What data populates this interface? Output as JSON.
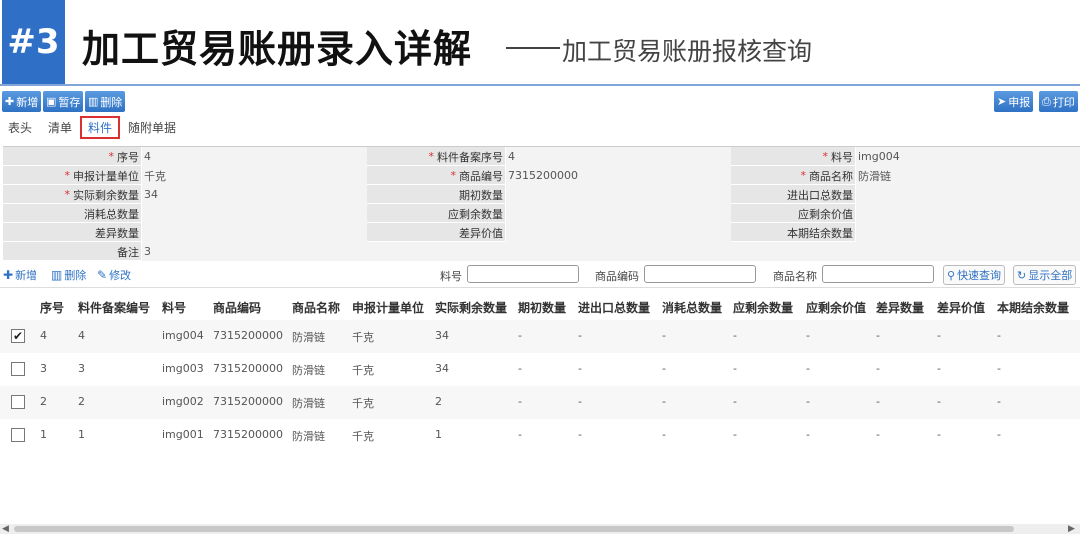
{
  "slide": {
    "badge": "#3",
    "title": "加工贸易账册录入详解",
    "subtitle": "加工贸易账册报核查询"
  },
  "toolbar": {
    "new_label": "新增",
    "save_label": "暂存",
    "delete_label": "删除",
    "declare_label": "申报",
    "print_label": "打印"
  },
  "tabs": [
    "表头",
    "清单",
    "料件",
    "随附单据"
  ],
  "active_tab": "料件",
  "form": {
    "seq_label": "序号",
    "seq_value": "4",
    "record_seq_label": "料件备案序号",
    "record_seq_value": "4",
    "item_no_label": "料号",
    "item_no_value": "img004",
    "unit_label": "申报计量单位",
    "unit_value": "千克",
    "goods_code_label": "商品编号",
    "goods_code_value": "7315200000",
    "goods_name_label": "商品名称",
    "goods_name_value": "防滑链",
    "actual_remain_label": "实际剩余数量",
    "actual_remain_value": "34",
    "initial_qty_label": "期初数量",
    "initial_qty_value": "",
    "import_export_label": "进出口总数量",
    "import_export_value": "",
    "consumed_label": "消耗总数量",
    "consumed_value": "",
    "should_remain_label": "应剩余数量",
    "should_remain_value": "",
    "should_remain_value_label": "应剩余价值",
    "should_remain_value_value": "",
    "diff_qty_label": "差异数量",
    "diff_qty_value": "",
    "diff_value_label": "差异价值",
    "diff_value_value": "",
    "period_end_label": "本期结余数量",
    "period_end_value": "",
    "remark_label": "备注",
    "remark_value": "3"
  },
  "list_toolbar": {
    "new_label": "新增",
    "delete_label": "删除",
    "edit_label": "修改",
    "item_no_label": "料号",
    "goods_code_label": "商品编码",
    "goods_name_label": "商品名称",
    "quick_query_label": "快速查询",
    "show_all_label": "显示全部"
  },
  "table": {
    "columns": [
      "序号",
      "料件备案编号",
      "料号",
      "商品编码",
      "商品名称",
      "申报计量单位",
      "实际剩余数量",
      "期初数量",
      "进出口总数量",
      "消耗总数量",
      "应剩余数量",
      "应剩余价值",
      "差异数量",
      "差异价值",
      "本期结余数量"
    ],
    "rows": [
      {
        "checked": true,
        "cells": [
          "4",
          "4",
          "img004",
          "7315200000",
          "防滑链",
          "千克",
          "34",
          "-",
          "-",
          "-",
          "-",
          "-",
          "-",
          "-",
          "-"
        ]
      },
      {
        "checked": false,
        "cells": [
          "3",
          "3",
          "img003",
          "7315200000",
          "防滑链",
          "千克",
          "34",
          "-",
          "-",
          "-",
          "-",
          "-",
          "-",
          "-",
          "-"
        ]
      },
      {
        "checked": false,
        "cells": [
          "2",
          "2",
          "img002",
          "7315200000",
          "防滑链",
          "千克",
          "2",
          "-",
          "-",
          "-",
          "-",
          "-",
          "-",
          "-",
          "-"
        ]
      },
      {
        "checked": false,
        "cells": [
          "1",
          "1",
          "img001",
          "7315200000",
          "防滑链",
          "千克",
          "1",
          "-",
          "-",
          "-",
          "-",
          "-",
          "-",
          "-",
          "-"
        ]
      }
    ]
  },
  "colors": {
    "accent": "#2f72c4",
    "badge": "#2f6fc6",
    "highlight_border": "#d93030"
  }
}
